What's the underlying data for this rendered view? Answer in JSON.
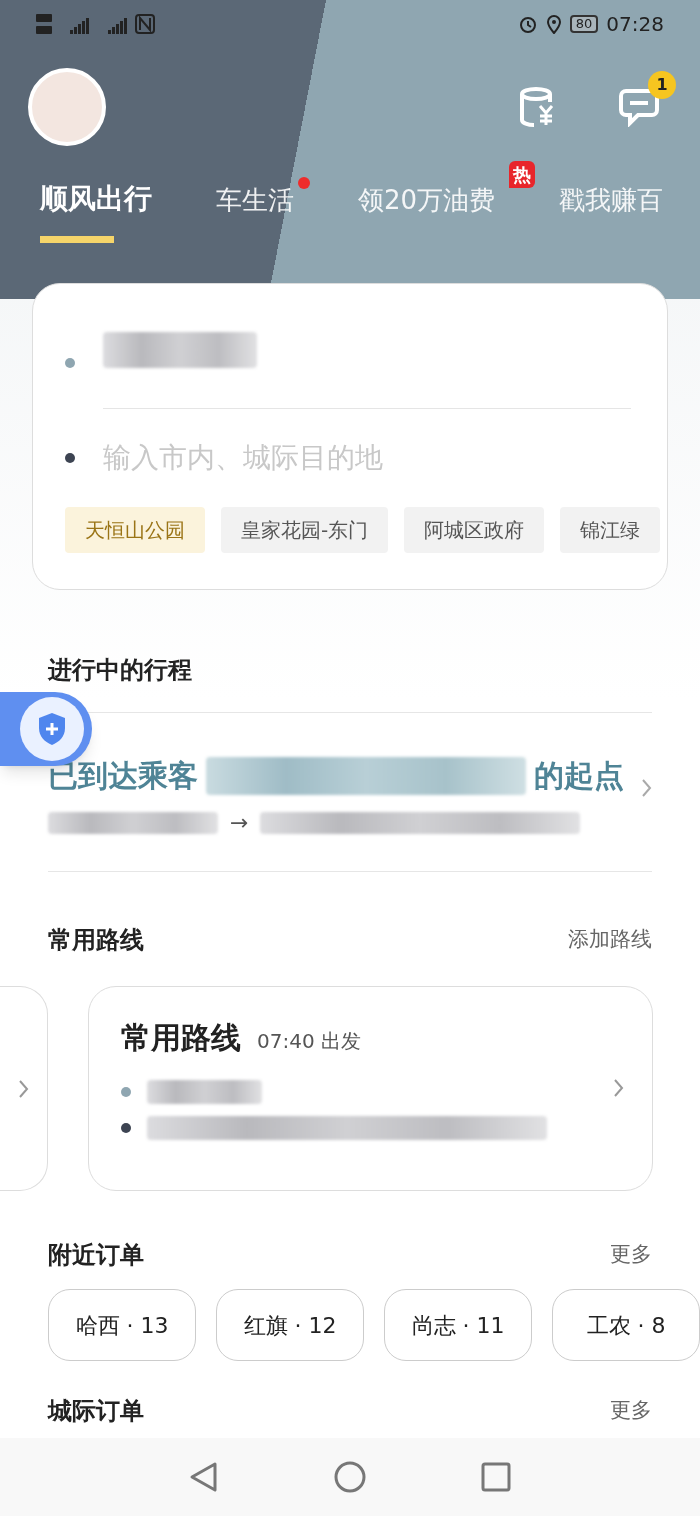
{
  "status_bar": {
    "time": "07:28",
    "battery": "80"
  },
  "header": {
    "message_badge": "1"
  },
  "tabs": [
    {
      "label": "顺风出行",
      "selected": true,
      "dot": false
    },
    {
      "label": "车生活",
      "selected": false,
      "dot": true
    },
    {
      "label": "领20万油费",
      "selected": false,
      "dot": false,
      "badge": "热"
    },
    {
      "label": "戳我赚百",
      "selected": false,
      "dot": false
    }
  ],
  "route_card": {
    "destination_placeholder": "输入市内、城际目的地",
    "chips": [
      {
        "label": "天恒山公园",
        "selected": true
      },
      {
        "label": "皇家花园-东门",
        "selected": false
      },
      {
        "label": "阿城区政府",
        "selected": false
      },
      {
        "label": "锦江绿",
        "selected": false
      }
    ]
  },
  "ongoing": {
    "title": "进行中的行程",
    "status_prefix": "已到达乘客",
    "status_suffix": "的起点",
    "arrow": "→"
  },
  "routes": {
    "title": "常用路线",
    "action": "添加路线",
    "card_title": "常用路线",
    "card_time": "07:40 出发"
  },
  "nearby": {
    "title": "附近订单",
    "action": "更多",
    "chips": [
      "哈西 · 13",
      "红旗 · 12",
      "尚志 · 11",
      "工农 · 8"
    ]
  },
  "intercity": {
    "title": "城际订单",
    "action": "更多"
  }
}
